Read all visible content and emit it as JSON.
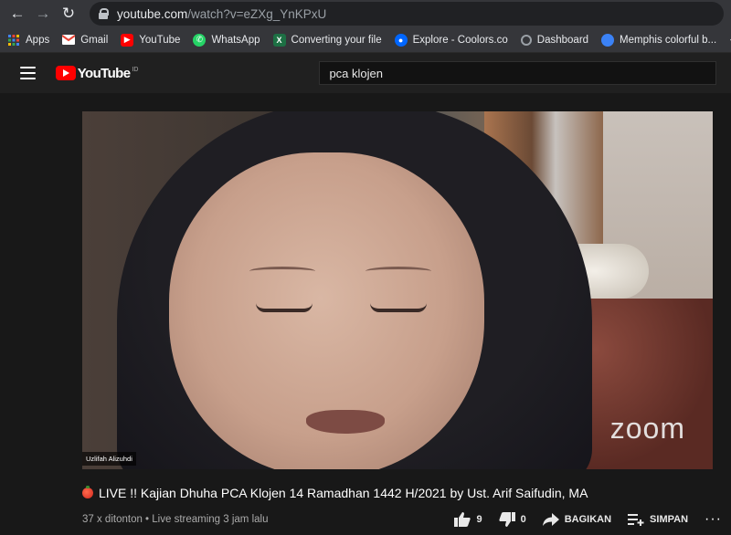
{
  "browser": {
    "url_domain": "youtube.com",
    "url_path": "/watch?v=eZXg_YnKPxU"
  },
  "bookmarks": [
    {
      "label": "Apps",
      "icon": "apps-grid-icon",
      "color": "#4285f4"
    },
    {
      "label": "Gmail",
      "icon": "gmail-icon",
      "color": "#ea4335"
    },
    {
      "label": "YouTube",
      "icon": "youtube-icon",
      "color": "#ff0000"
    },
    {
      "label": "WhatsApp",
      "icon": "whatsapp-icon",
      "color": "#25d366"
    },
    {
      "label": "Converting your file",
      "icon": "excel-icon",
      "color": "#1d7044"
    },
    {
      "label": "Explore - Coolors.co",
      "icon": "coolors-icon",
      "color": "#0066ff"
    },
    {
      "label": "Dashboard",
      "icon": "dashboard-icon",
      "color": "#5f6368"
    },
    {
      "label": "Memphis colorful b...",
      "icon": "memphis-icon",
      "color": "#3b82f6"
    }
  ],
  "header": {
    "logo_text": "YouTube",
    "logo_region": "ID",
    "search_value": "pca klojen"
  },
  "video": {
    "participant_name": "Uzlifah Alizuhdi",
    "watermark": "zoom"
  },
  "info": {
    "title": "LIVE !! Kajian Dhuha PCA Klojen 14 Ramadhan 1442 H/2021 by Ust. Arif Saifudin, MA",
    "views": "37 x ditonton",
    "separator": " • ",
    "stream_status": "Live streaming 3 jam lalu",
    "likes": "9",
    "dislikes": "0",
    "share_label": "BAGIKAN",
    "save_label": "SIMPAN",
    "more": "···"
  },
  "colors": {
    "brand_red": "#ff0000",
    "page_bg": "#181818",
    "header_bg": "#202020"
  }
}
